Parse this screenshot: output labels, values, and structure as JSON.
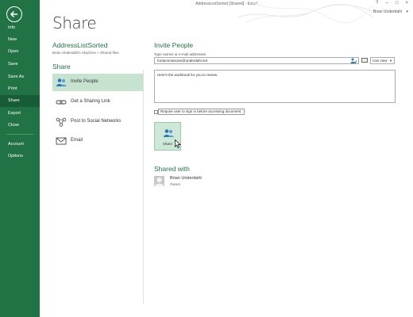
{
  "window": {
    "title": "AddressListSorted  [Shared] - Excel",
    "controls": [
      "?",
      "–",
      "□",
      "×"
    ],
    "user_name": "Brian Underdahl",
    "user_caret": "▾"
  },
  "nav": {
    "items": [
      {
        "label": "Info"
      },
      {
        "label": "New"
      },
      {
        "label": "Open"
      },
      {
        "label": "Save"
      },
      {
        "label": "Save As"
      },
      {
        "label": "Print"
      },
      {
        "label": "Share"
      },
      {
        "label": "Export"
      },
      {
        "label": "Close"
      },
      {
        "label": "Account"
      },
      {
        "label": "Options"
      }
    ],
    "active": "Share",
    "background_color": "#217346"
  },
  "page": {
    "title": "Share"
  },
  "document": {
    "name": "AddressListSorted",
    "path": "Brian Underdahl's SkyDrive » Shared files"
  },
  "share_pane": {
    "heading": "Share",
    "options": [
      {
        "label": "Invite People",
        "icon": "invite-people-icon"
      },
      {
        "label": "Get a Sharing Link",
        "icon": "link-icon"
      },
      {
        "label": "Post to Social Networks",
        "icon": "social-networks-icon"
      },
      {
        "label": "Email",
        "icon": "email-icon"
      }
    ],
    "selected": "Invite People"
  },
  "invite": {
    "heading": "Invite People",
    "field_label": "Type names or e-mail addresses",
    "email_value": "fordummiesone@underdahl.net",
    "permission": "Can view",
    "message": "Here's the workbook for you to review.",
    "require_signin_label": "Require user to sign in before accessing document.",
    "require_signin_checked": false,
    "share_button_label": "Share"
  },
  "shared_with": {
    "heading": "Shared with",
    "people": [
      {
        "name": "Brian Underdahl",
        "role": "Owner"
      }
    ]
  },
  "accent_color": "#217346",
  "selected_color": "#c6e3d0"
}
